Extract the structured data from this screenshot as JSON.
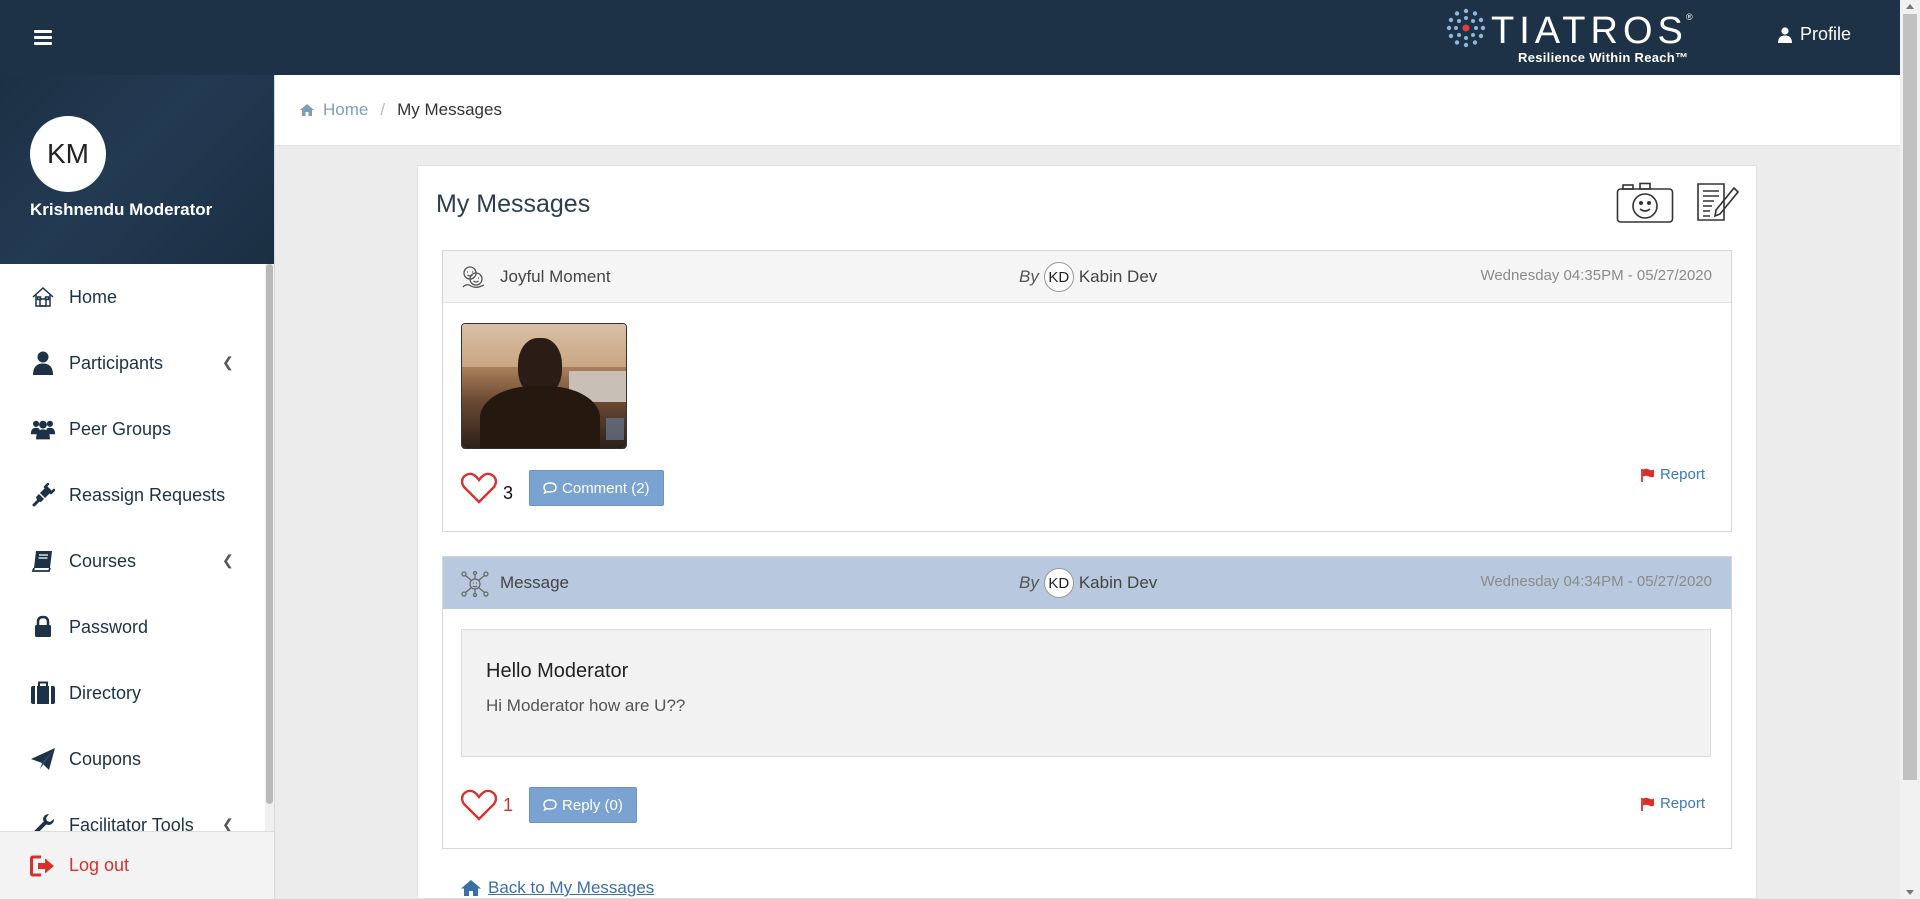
{
  "header": {
    "logo_text": "TIATROS",
    "logo_reg": "®",
    "logo_tagline": "Resilience Within Reach™",
    "profile_label": "Profile"
  },
  "sidebar": {
    "user_initials": "KM",
    "user_name": "Krishnendu Moderator",
    "items": [
      {
        "label": "Home",
        "icon": "home-icon"
      },
      {
        "label": "Participants",
        "icon": "user-icon",
        "has_submenu": true
      },
      {
        "label": "Peer Groups",
        "icon": "users-icon"
      },
      {
        "label": "Reassign Requests",
        "icon": "plug-icon"
      },
      {
        "label": "Courses",
        "icon": "book-icon",
        "has_submenu": true
      },
      {
        "label": "Password",
        "icon": "lock-icon"
      },
      {
        "label": "Directory",
        "icon": "briefcase-icon"
      },
      {
        "label": "Coupons",
        "icon": "paper-plane-icon"
      },
      {
        "label": "Facilitator Tools",
        "icon": "wrench-icon",
        "has_submenu": true
      }
    ],
    "logout_label": "Log out"
  },
  "breadcrumb": {
    "home": "Home",
    "separator": "/",
    "current": "My Messages"
  },
  "main": {
    "title": "My Messages",
    "posts": [
      {
        "type": "Joyful Moment",
        "by": "By",
        "author_initials": "KD",
        "author": "Kabin Dev",
        "date": "Wednesday 04:35PM - 05/27/2020",
        "likes": "3",
        "action_label": "Comment (2)",
        "report_label": "Report"
      },
      {
        "type": "Message",
        "by": "By",
        "author_initials": "KD",
        "author": "Kabin Dev",
        "date": "Wednesday 04:34PM - 05/27/2020",
        "message_title": "Hello Moderator",
        "message_text": "Hi Moderator how are U??",
        "likes": "1",
        "action_label": "Reply (0)",
        "report_label": "Report"
      }
    ],
    "back_link": "Back to My Messages"
  },
  "colors": {
    "topbar": "#1d3247",
    "accent_blue": "#7ba3d1",
    "active_post_header": "#b8c9df",
    "logout_red": "#d9302c",
    "heart_red": "#d9302c"
  }
}
